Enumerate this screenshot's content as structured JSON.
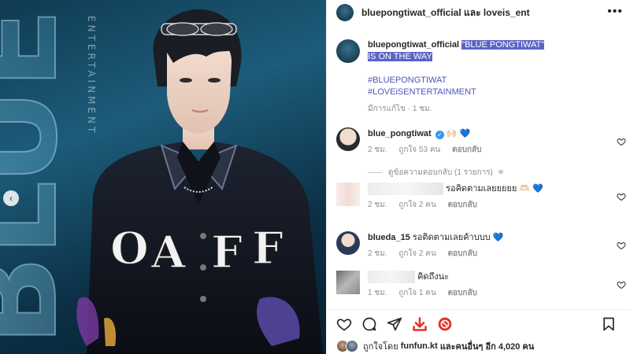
{
  "header": {
    "user1": "bluepongtiwat_official",
    "and": "และ",
    "user2": "loveis_ent",
    "more_label": "•••"
  },
  "caption": {
    "username": "bluepongtiwat_official",
    "headline_line1": "\"BLUE PONGTIWAT\"",
    "headline_line2": "IS ON THE WAY",
    "hashtags": [
      "#BLUEPONGTIWAT",
      "#LOVEiSENTERTAINMENT"
    ],
    "meta": "มีการแก้ไข · 1 ชม."
  },
  "comments": [
    {
      "username": "blue_pongtiwat",
      "text": "🙌🏻 💙",
      "verified": true,
      "time": "2 ชม.",
      "likes": "ถูกใจ 53 คน",
      "reply_label": "ตอบกลับ"
    },
    {
      "username": "",
      "text": "รอคิดตามเลยยยยย 🫶🏻 💙",
      "time": "2 ชม.",
      "likes": "ถูกใจ 2 คน",
      "reply_label": "ตอบกลับ"
    },
    {
      "username": "blueda_15",
      "text": "รอติดตามเลยค้าบบบ 💙",
      "time": "2 ชม.",
      "likes": "ถูกใจ 2 คน",
      "reply_label": "ตอบกลับ"
    },
    {
      "username": "",
      "text": "คิดถึงนะ",
      "time": "1 ชม.",
      "likes": "ถูกใจ 1 คน",
      "reply_label": "ตอบกลับ"
    }
  ],
  "replies_toggle": "ดูข้อความตอบกลับ (1 รายการ)",
  "liked_by": {
    "prefix": "ถูกใจโดย",
    "user": "funfun.kt",
    "suffix": "และคนอื่นๆ อีก 4,020 คน"
  },
  "image": {
    "background_text": "BLUE",
    "side_text": "ENTERTAINMENT",
    "jacket_text": "OFF"
  },
  "colors": {
    "highlight": "#5b64c7",
    "hashtag": "#4a57b8",
    "verified": "#3897f0",
    "share_red": "#e0312a"
  }
}
